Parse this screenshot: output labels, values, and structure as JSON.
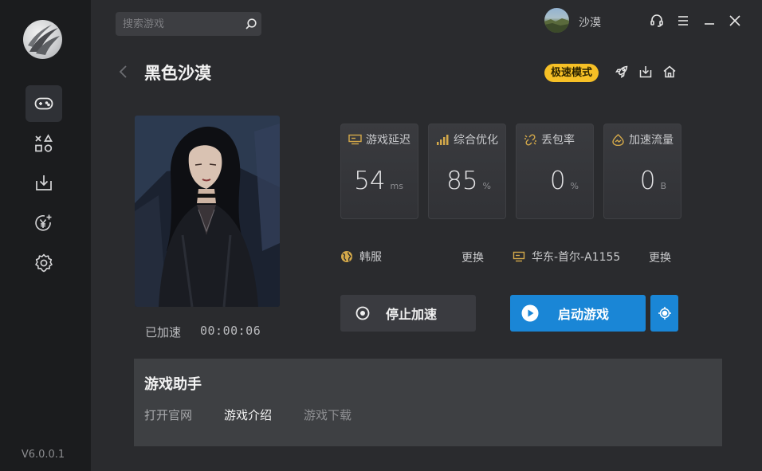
{
  "app": {
    "version": "V6.0.0.1"
  },
  "sidebar": {
    "items": [
      {
        "name": "games",
        "icon": "gamepad-icon",
        "active": true
      },
      {
        "name": "categories",
        "icon": "shapes-icon",
        "active": false
      },
      {
        "name": "downloads",
        "icon": "download-icon",
        "active": false
      },
      {
        "name": "recharge",
        "icon": "yen-coin-icon",
        "active": false
      },
      {
        "name": "settings",
        "icon": "gear-icon",
        "active": false
      }
    ]
  },
  "header": {
    "search_placeholder": "搜索游戏",
    "user_name": "沙漠"
  },
  "game": {
    "title": "黑色沙漠",
    "mode_badge": "极速模式",
    "accel_label": "已加速",
    "accel_time": "00:00:06"
  },
  "stats": [
    {
      "title": "游戏延迟",
      "value": "54",
      "unit": "ms",
      "icon": "latency-icon"
    },
    {
      "title": "综合优化",
      "value": "85",
      "unit": "%",
      "icon": "signal-bars-icon"
    },
    {
      "title": "丢包率",
      "value": "0",
      "unit": "%",
      "icon": "broken-link-icon"
    },
    {
      "title": "加速流量",
      "value": "0",
      "unit": "B",
      "icon": "flow-icon"
    }
  ],
  "region": {
    "server": "韩服",
    "node": "华东-首尔-A1155",
    "change_label": "更换"
  },
  "actions": {
    "stop_label": "停止加速",
    "start_label": "启动游戏"
  },
  "assistant": {
    "title": "游戏助手",
    "tabs": [
      "打开官网",
      "游戏介绍",
      "游戏下载"
    ]
  },
  "colors": {
    "accent_blue": "#1a86d6",
    "badge_yellow": "#f6c026",
    "sidebar_bg": "#1b1c1e",
    "main_bg": "#2a2b2e"
  }
}
